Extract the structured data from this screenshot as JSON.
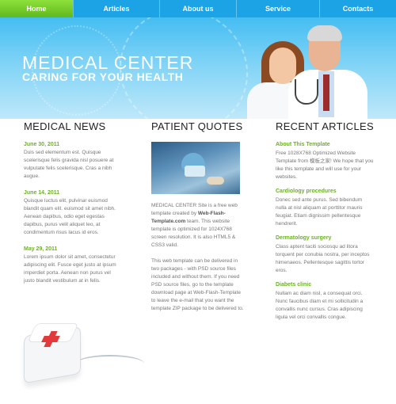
{
  "nav": {
    "items": [
      "Home",
      "Articles",
      "About us",
      "Service",
      "Contacts"
    ],
    "active": "Home"
  },
  "header": {
    "title": "MEDICAL CENTER",
    "subtitle": "CARING FOR YOUR HEALTH"
  },
  "news": {
    "heading": "MEDICAL NEWS",
    "items": [
      {
        "date": "June 30, 2011",
        "text": "Duis sed elementum est. Quisque scelerisque felis gravida nisl posuere at vulputate felis scelerisque. Cras a nibh augue."
      },
      {
        "date": "June 14, 2011",
        "text": "Quisque luctus elit, pulvinar euismod blandit quam elit. euismod sit amet nibh. Aenean dapibus, odio eget egestas dapibus, purus velit aliquet leo, at condimentum risus lacus id eros."
      },
      {
        "date": "May 29, 2011",
        "text": "Lorem ipsum dolor sit amet, consectetur adipiscing elit. Fusce eget justo at ipsum imperdiet porta. Aenean non purus vel justo blandit vestibulum at in felis."
      }
    ]
  },
  "quotes": {
    "heading": "PATIENT QUOTES",
    "p1": {
      "a": "MEDICAL CENTER Site is a free web template created by ",
      "b": "Web-Flash-Template.com",
      "c": " team. This website template is optimized for 1024X768 screen resolution. It is also HTML5 & CSS3 valid."
    },
    "p2": "This web template can be delivered in two packages - with PSD source files included and without them. If you need PSD source files, go to the template download page at Web-Flash-Template to leave the e-mail that you want the template ZIP package to be delivered to."
  },
  "articles": {
    "heading": "RECENT ARTICLES",
    "items": [
      {
        "title": "About This Template",
        "text": "Free 1028X768 Optimized Website Template from 模板之家! We hope that you like this template and will use for your websites."
      },
      {
        "title": "Cardiology procedures",
        "text": "Donec sed ante purus. Sed bibendum nulla at nisl aliquam at porttitor mauris feugiat. Etiam dignissim pellentesque hendrerit."
      },
      {
        "title": "Dermatology surgery",
        "text": "Class aptent taciti sociosqu ad litora torquent per conubia nostra, per inceptos himenaeos. Pellentesque sagittis tortor eros."
      },
      {
        "title": "Diabets clinic",
        "text": "Nullam ac diam nisl, a consequat orci. Nunc faucibus diam et mi sollicitudin a convallis nunc cursus. Cras adipiscing ligula vel orci convallis congue."
      }
    ]
  },
  "colors": {
    "nav_bg": "#1ba3e6",
    "nav_active": "#6bc22a",
    "accent_green": "#6bb31f",
    "header_blue": "#44bdf2"
  }
}
